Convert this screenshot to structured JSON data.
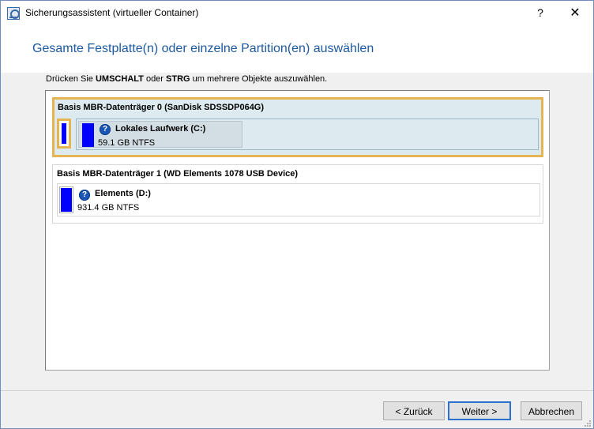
{
  "window": {
    "title": "Sicherungsassistent (virtueller Container)",
    "help_label": "?",
    "close_label": "✕"
  },
  "header": {
    "heading": "Gesamte Festplatte(n) oder einzelne Partition(en) auswählen"
  },
  "instruction": {
    "prefix": "Drücken Sie ",
    "key1": "UMSCHALT",
    "middle": " oder ",
    "key2": "STRG",
    "suffix": " um mehrere Objekte auszuwählen."
  },
  "disks": [
    {
      "title": "Basis MBR-Datenträger 0 (SanDisk SDSSDP064G)",
      "selected": true,
      "partitions": [
        {
          "name": "Lokales Laufwerk (C:)",
          "size": "59.1 GB NTFS"
        }
      ]
    },
    {
      "title": "Basis MBR-Datenträger 1 (WD Elements 1078 USB Device)",
      "selected": false,
      "partitions": [
        {
          "name": "Elements (D:)",
          "size": "931.4 GB NTFS"
        }
      ]
    }
  ],
  "buttons": {
    "back": "< Zurück",
    "next": "Weiter >",
    "cancel": "Abbrechen"
  },
  "icons": {
    "help": "?",
    "help_color": "#1a56b5",
    "partition_color": "#0000ff",
    "selection_color": "#e5b553",
    "heading_color": "#1e5aa0"
  }
}
